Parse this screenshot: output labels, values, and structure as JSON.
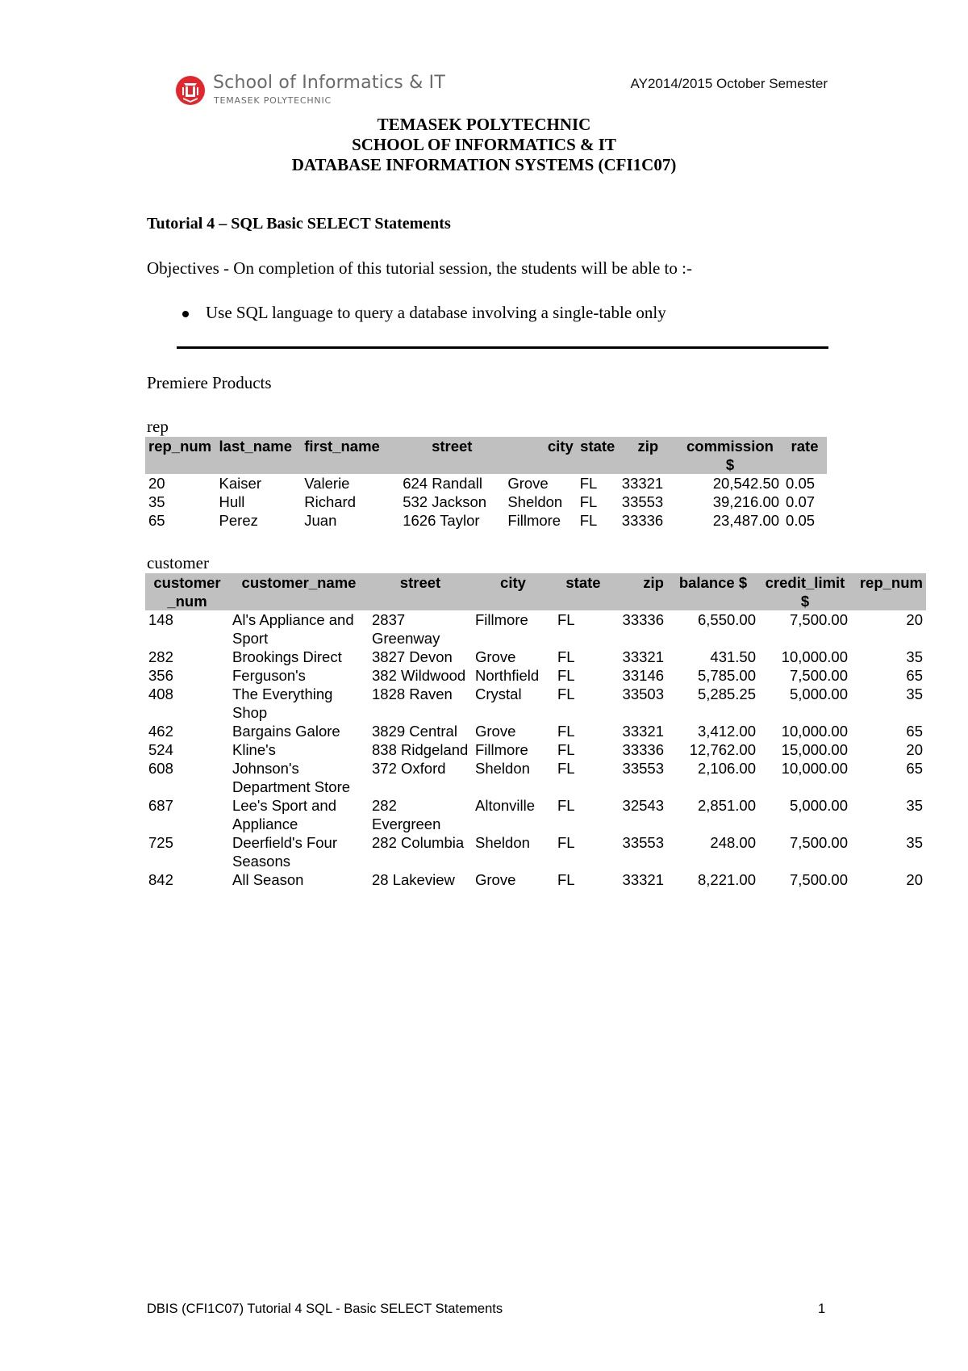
{
  "header": {
    "logo_title": "School of Informatics & IT",
    "logo_subtitle": "TEMASEK POLYTECHNIC",
    "semester": "AY2014/2015 October Semester",
    "brand_color": "#e3262b"
  },
  "headings": [
    "TEMASEK POLYTECHNIC",
    "SCHOOL OF INFORMATICS & IT",
    "DATABASE INFORMATION SYSTEMS (CFI1C07)"
  ],
  "tutorial_title": "Tutorial 4 – SQL Basic SELECT Statements",
  "objectives": "Objectives - On completion of this tutorial session, the students will be able to :-",
  "bullets": [
    "Use SQL language to query a database involving a single-table only"
  ],
  "section_title": "Premiere Products",
  "rep_table": {
    "label": "rep",
    "columns": [
      "rep_num",
      "last_name",
      "first_name",
      "street",
      "city",
      "state",
      "zip",
      "commission $",
      "rate"
    ],
    "rows": [
      [
        "20",
        "Kaiser",
        "Valerie",
        "624 Randall",
        "Grove",
        "FL",
        "33321",
        "20,542.50",
        "0.05"
      ],
      [
        "35",
        "Hull",
        "Richard",
        "532 Jackson",
        "Sheldon",
        "FL",
        "33553",
        "39,216.00",
        "0.07"
      ],
      [
        "65",
        "Perez",
        "Juan",
        "1626 Taylor",
        "Fillmore",
        "FL",
        "33336",
        "23,487.00",
        "0.05"
      ]
    ]
  },
  "customer_table": {
    "label": "customer",
    "columns": [
      "customer _num",
      "customer_name",
      "street",
      "city",
      "state",
      "zip",
      "balance $",
      "credit_limit $",
      "rep_num"
    ],
    "rows": [
      [
        "148",
        "Al's Appliance and Sport",
        "2837 Greenway",
        "Fillmore",
        "FL",
        "33336",
        "6,550.00",
        "7,500.00",
        "20"
      ],
      [
        "282",
        "Brookings Direct",
        "3827 Devon",
        "Grove",
        "FL",
        "33321",
        "431.50",
        "10,000.00",
        "35"
      ],
      [
        "356",
        "Ferguson's",
        "382 Wildwood",
        "Northfield",
        "FL",
        "33146",
        "5,785.00",
        "7,500.00",
        "65"
      ],
      [
        "408",
        "The Everything Shop",
        "1828 Raven",
        "Crystal",
        "FL",
        "33503",
        "5,285.25",
        "5,000.00",
        "35"
      ],
      [
        "462",
        "Bargains Galore",
        "3829 Central",
        "Grove",
        "FL",
        "33321",
        "3,412.00",
        "10,000.00",
        "65"
      ],
      [
        "524",
        "Kline's",
        "838 Ridgeland",
        "Fillmore",
        "FL",
        "33336",
        "12,762.00",
        "15,000.00",
        "20"
      ],
      [
        "608",
        "Johnson's Department Store",
        "372 Oxford",
        "Sheldon",
        "FL",
        "33553",
        "2,106.00",
        "10,000.00",
        "65"
      ],
      [
        "687",
        "Lee's Sport and Appliance",
        "282 Evergreen",
        "Altonville",
        "FL",
        "32543",
        "2,851.00",
        "5,000.00",
        "35"
      ],
      [
        "725",
        "Deerfield's Four Seasons",
        "282 Columbia",
        "Sheldon",
        "FL",
        "33553",
        "248.00",
        "7,500.00",
        "35"
      ],
      [
        "842",
        "All Season",
        "28 Lakeview",
        "Grove",
        "FL",
        "33321",
        "8,221.00",
        "7,500.00",
        "20"
      ]
    ]
  },
  "footer": {
    "text": "DBIS (CFI1C07) Tutorial 4 SQL - Basic SELECT Statements",
    "page_number": "1"
  }
}
